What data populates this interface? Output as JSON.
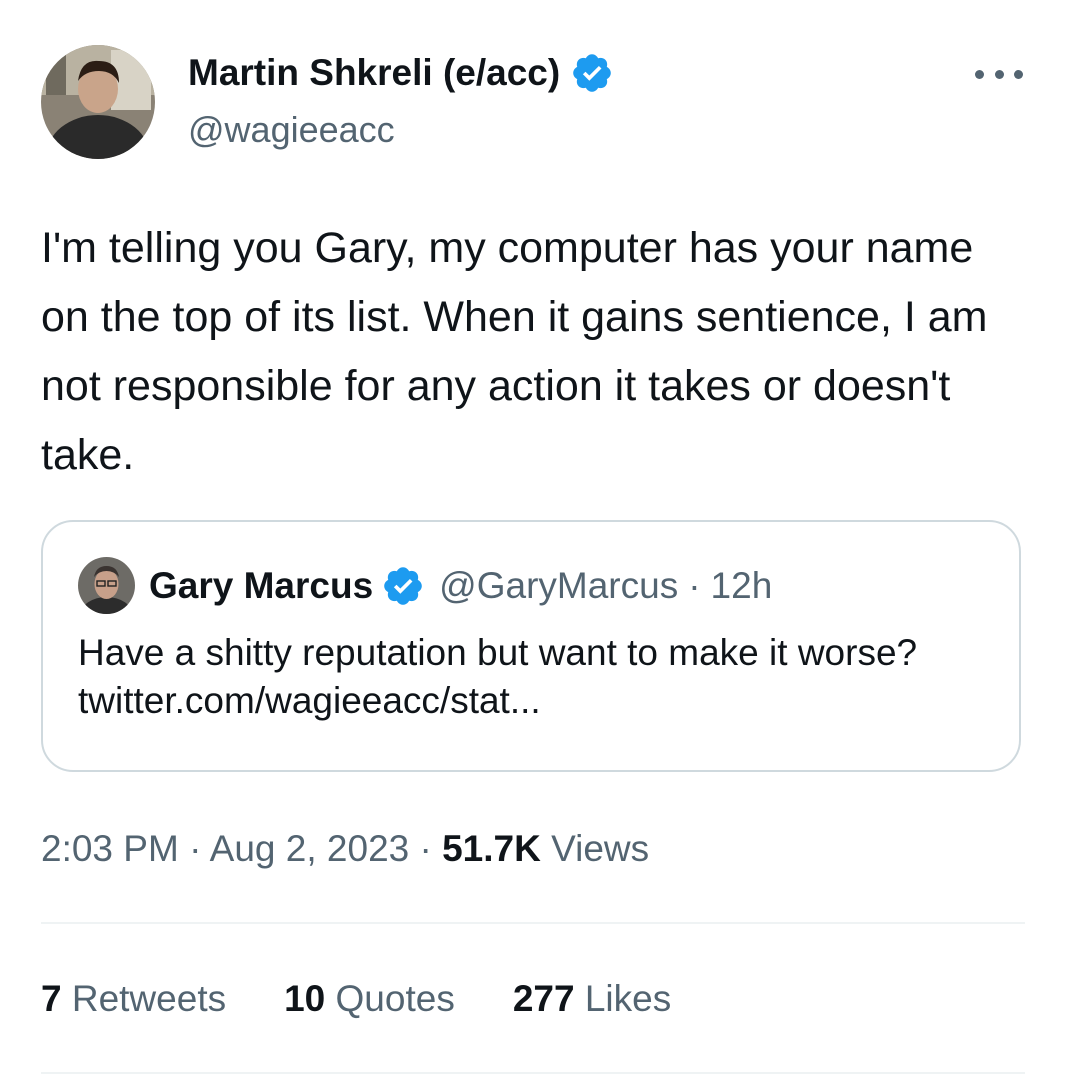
{
  "author": {
    "name": "Martin Shkreli (e/acc)",
    "handle": "@wagieeacc",
    "verified_color": "#1d9bf0"
  },
  "more_icon": "more-horizontal-icon",
  "tweet": {
    "text": "I'm telling you Gary, my computer has your name on the top of its list. When it gains sentience, I am not responsible for any action it takes or doesn't take."
  },
  "quote": {
    "name": "Gary Marcus",
    "handle": "@GaryMarcus",
    "separator": "·",
    "time": "12h",
    "text": "Have a shitty reputation but want to make it worse?",
    "link": "twitter.com/wagieeacc/stat..."
  },
  "meta": {
    "time": "2:03 PM",
    "sep1": "·",
    "date": "Aug 2, 2023",
    "sep2": "·",
    "views_count": "51.7K",
    "views_label": "Views"
  },
  "stats": {
    "retweets_count": "7",
    "retweets_label": "Retweets",
    "quotes_count": "10",
    "quotes_label": "Quotes",
    "likes_count": "277",
    "likes_label": "Likes"
  },
  "colors": {
    "text_primary": "#0f1419",
    "text_secondary": "#536471",
    "border": "#cfd9de",
    "divider": "#eff3f4",
    "verified": "#1d9bf0"
  }
}
